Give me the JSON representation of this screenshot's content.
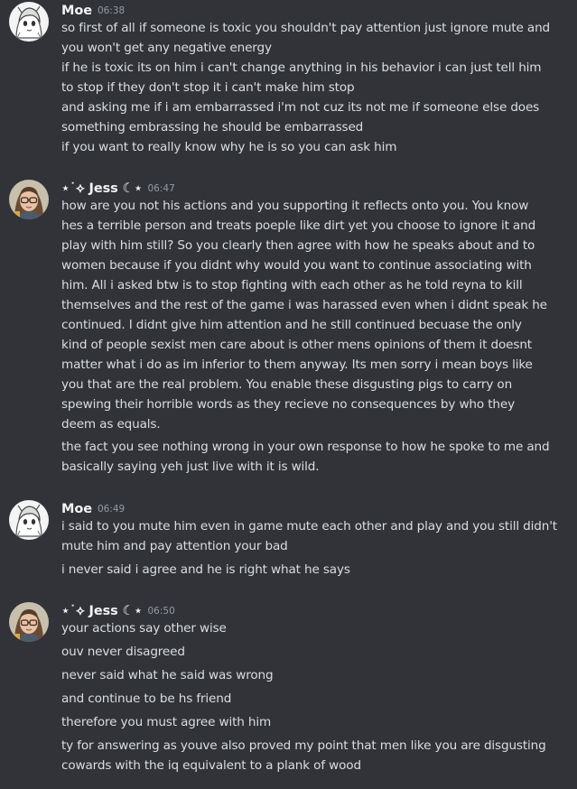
{
  "messages": [
    {
      "author": "Moe",
      "avatar_icon": "anime-sketch-avatar-icon",
      "time": "06:38",
      "lines": [
        "so first of all if someone is toxic you shouldn't pay attention just ignore mute and",
        "you won't get any negative energy",
        "if he is toxic its on him i can't change anything in his behavior i can just tell him",
        "to stop if they don't stop it i can't make him stop",
        "and asking me if i am embarrassed i'm not cuz its not me if someone else does",
        "something embrassing he should be embarrassed",
        "if you want to really know why he is so you can ask him"
      ]
    },
    {
      "author": "⋆˙⟡ Jess ☾⋆",
      "avatar_icon": "woman-with-glasses-avatar-icon",
      "time": "06:47",
      "lines": [
        "how are you not his actions and you supporting it reflects onto you. You know",
        "hes a terrible person and treats poeple like dirt yet you choose to ignore it and",
        "play with him still? So you clearly then agree with how he speaks about and to",
        "women because if you didnt why would you want to continue associating with",
        "him. All i asked btw is to stop fighting with each other as he told reyna to kill",
        "themselves and the rest of the game i was harassed even when i didnt speak he",
        "continued. I didnt give him attention and he still continued becuase the only",
        "kind of people sexist men care about is other mens opinions of them it doesnt",
        "matter what i do as im inferior to them anyway. Its men sorry i mean boys like",
        "you that are the real problem. You enable these disgusting pigs to carry on",
        "spewing their horrible words as they recieve no consequences by who they",
        "deem as equals.",
        "the fact you see nothing wrong in your own response to how he spoke to me and",
        "basically saying yeh just live with it is wild."
      ]
    },
    {
      "author": "Moe",
      "avatar_icon": "anime-sketch-avatar-icon",
      "time": "06:49",
      "lines": [
        "i said to you mute him even in game mute each other and play and you still didn't",
        "mute him and pay attention your bad",
        "i never said i agree and he is right what he says"
      ]
    },
    {
      "author": "⋆˙⟡ Jess ☾⋆",
      "avatar_icon": "woman-with-glasses-avatar-icon",
      "time": "06:50",
      "lines": [
        "your actions say other wise",
        "ouv never disagreed",
        "never said what he said was wrong",
        "and continue to be hs friend",
        "therefore you must agree with him",
        "ty for answering as youve also proved my point that men like you are disgusting",
        "cowards with the iq equivalent to a plank of wood"
      ]
    }
  ]
}
